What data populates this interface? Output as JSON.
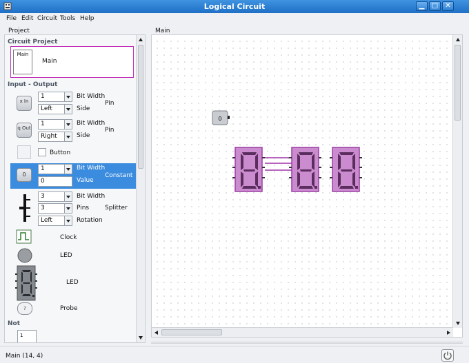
{
  "window": {
    "title": "Logical Circuit"
  },
  "menu": {
    "file": "File",
    "edit": "Edit",
    "circuit": "Circuit",
    "tools": "Tools",
    "help": "Help"
  },
  "panels": {
    "project": "Project",
    "main": "Main"
  },
  "project": {
    "section": "Circuit Project",
    "thumb_label": "Main",
    "name": "Main"
  },
  "io": {
    "section": "Input - Output",
    "pin_in": {
      "icon_text": "x In",
      "bit_width": "1",
      "bit_width_label": "Bit Width",
      "side": "Left",
      "side_label": "Side",
      "name": "Pin"
    },
    "pin_out": {
      "icon_text": "q Out",
      "bit_width": "1",
      "bit_width_label": "Bit Width",
      "side": "Right",
      "side_label": "Side",
      "name": "Pin"
    },
    "button": {
      "name": "Button"
    },
    "constant": {
      "icon_text": "0",
      "bit_width": "1",
      "bit_width_label": "Bit Width",
      "value": "0",
      "value_label": "Value",
      "name": "Constant"
    },
    "splitter": {
      "bit_width": "3",
      "bit_width_label": "Bit Width",
      "pins": "3",
      "pins_label": "Pins",
      "rotation": "Left",
      "rotation_label": "Rotation",
      "name": "Splitter"
    },
    "clock": {
      "name": "Clock"
    },
    "led": {
      "name": "LED"
    },
    "seven_seg": {
      "name": "LED"
    },
    "probe": {
      "icon_text": "?",
      "name": "Probe"
    }
  },
  "not_section": {
    "section": "Not",
    "icon_text": "1"
  },
  "canvas": {
    "constant_value": "0"
  },
  "status": {
    "text": "Main (14, 4)"
  }
}
